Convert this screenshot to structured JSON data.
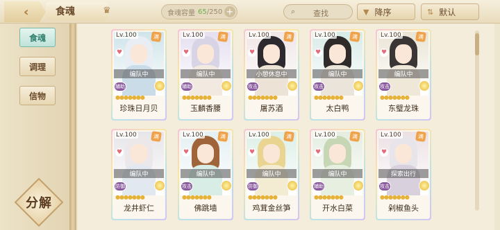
{
  "topbar": {
    "title": "食魂",
    "capacity_label": "食魂容量",
    "capacity_current": "65",
    "capacity_max": "/250",
    "search_placeholder": "查找",
    "sort_desc_label": "降序",
    "sort_default_label": "默认"
  },
  "sidebar": {
    "tabs": [
      {
        "label": "食魂",
        "active": true
      },
      {
        "label": "调理",
        "active": false
      },
      {
        "label": "信物",
        "active": false
      }
    ],
    "decompose_label": "分解"
  },
  "cards": [
    {
      "level": "Lv.100",
      "status": "编队中",
      "role": "辅助",
      "name": "珍珠日月贝",
      "hair": "#e9eef4",
      "outfit": "#c9dce8",
      "bg": "#cfe4ea"
    },
    {
      "level": "Lv.100",
      "status": "编队中",
      "role": "辅助",
      "name": "玉麟香腰",
      "hair": "#d8d4e6",
      "outfit": "#f2e9e0",
      "bg": "#e5dff0"
    },
    {
      "level": "Lv.100",
      "status": "小憩休息中",
      "role": "攻击",
      "name": "屠苏酒",
      "hair": "#2c2a2e",
      "outfit": "#ece3d6",
      "bg": "#f0e6e6"
    },
    {
      "level": "Lv.100",
      "status": "编队中",
      "role": "攻击",
      "name": "太白鸭",
      "hair": "#2f2b2b",
      "outfit": "#eae4da",
      "bg": "#d8ebe7"
    },
    {
      "level": "Lv.100",
      "status": "编队中",
      "role": "攻击",
      "name": "东璧龙珠",
      "hair": "#3a3636",
      "outfit": "#efe7d8",
      "bg": "#e9e4d4"
    },
    {
      "level": "Lv.100",
      "status": "编队中",
      "role": "防御",
      "name": "龙井虾仁",
      "hair": "#ece8ea",
      "outfit": "#e2e8ef",
      "bg": "#e6e6ea"
    },
    {
      "level": "Lv.100",
      "status": "编队中",
      "role": "攻击",
      "name": "佛跳墙",
      "hair": "#a0643a",
      "outfit": "#d8ede6",
      "bg": "#e4f0f2"
    },
    {
      "level": "Lv.100",
      "status": "编队中",
      "role": "防御",
      "name": "鸡茸金丝笋",
      "hair": "#e9d492",
      "outfit": "#f4ecd2",
      "bg": "#dcefe6"
    },
    {
      "level": "Lv.100",
      "status": "编队中",
      "role": "辅助",
      "name": "开水白菜",
      "hair": "#c7d7b6",
      "outfit": "#e6efe0",
      "bg": "#e4ede0"
    },
    {
      "level": "Lv.100",
      "status": "探索出行",
      "role": "攻击",
      "name": "剁椒鱼头",
      "hair": "#e7e4ea",
      "outfit": "#d8d0dc",
      "bg": "#ece0e4"
    }
  ],
  "full_badge": "满",
  "stars": "●●●●●●●"
}
